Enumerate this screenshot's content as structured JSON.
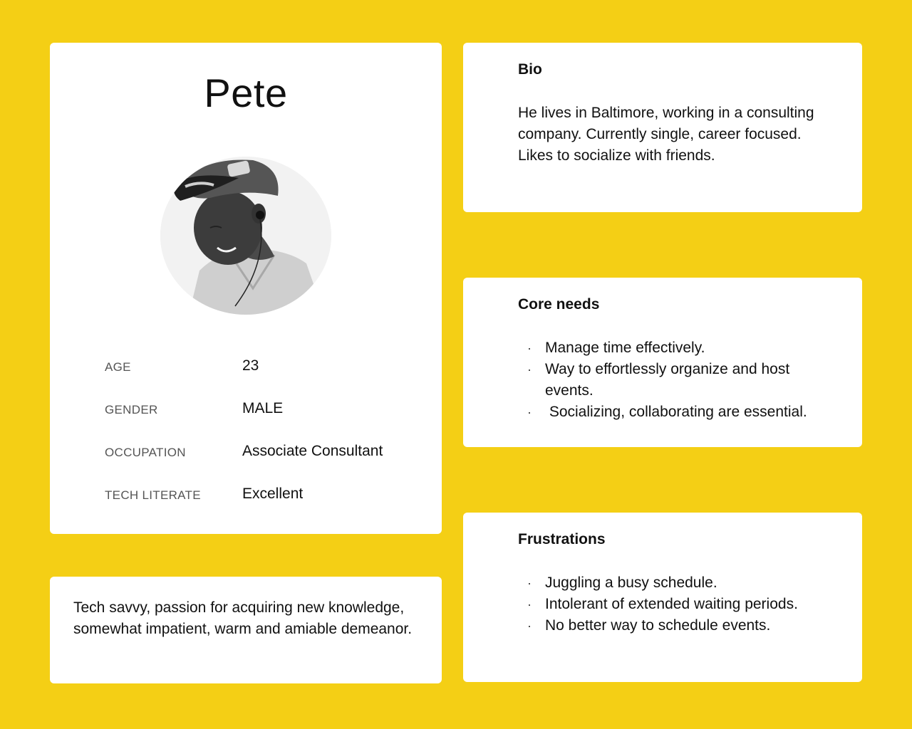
{
  "persona": {
    "name": "Pete",
    "attributes": [
      {
        "label": "AGE",
        "value": "23"
      },
      {
        "label": "GENDER",
        "value": "MALE"
      },
      {
        "label": "OCCUPATION",
        "value": "Associate Consultant"
      },
      {
        "label": "TECH LITERATE",
        "value": "Excellent"
      }
    ],
    "summary": "Tech savvy, passion for acquiring new knowledge, somewhat impatient, warm and amiable demeanor."
  },
  "bio": {
    "title": "Bio",
    "text": "He lives in Baltimore, working in a consulting company. Currently single, career focused. Likes to socialize with friends."
  },
  "core_needs": {
    "title": "Core needs",
    "items": [
      "Manage time effectively.",
      "Way to effortlessly organize and host events.",
      " Socializing, collaborating are essential."
    ]
  },
  "frustrations": {
    "title": "Frustrations",
    "items": [
      "Juggling a busy schedule.",
      "Intolerant of extended waiting periods.",
      "No better way to schedule events."
    ]
  },
  "bullet_glyph": "·",
  "colors": {
    "background": "#F4CF15",
    "card": "#FFFFFF",
    "text": "#111111",
    "label": "#555555"
  },
  "icons": {
    "avatar": "person-photo"
  }
}
